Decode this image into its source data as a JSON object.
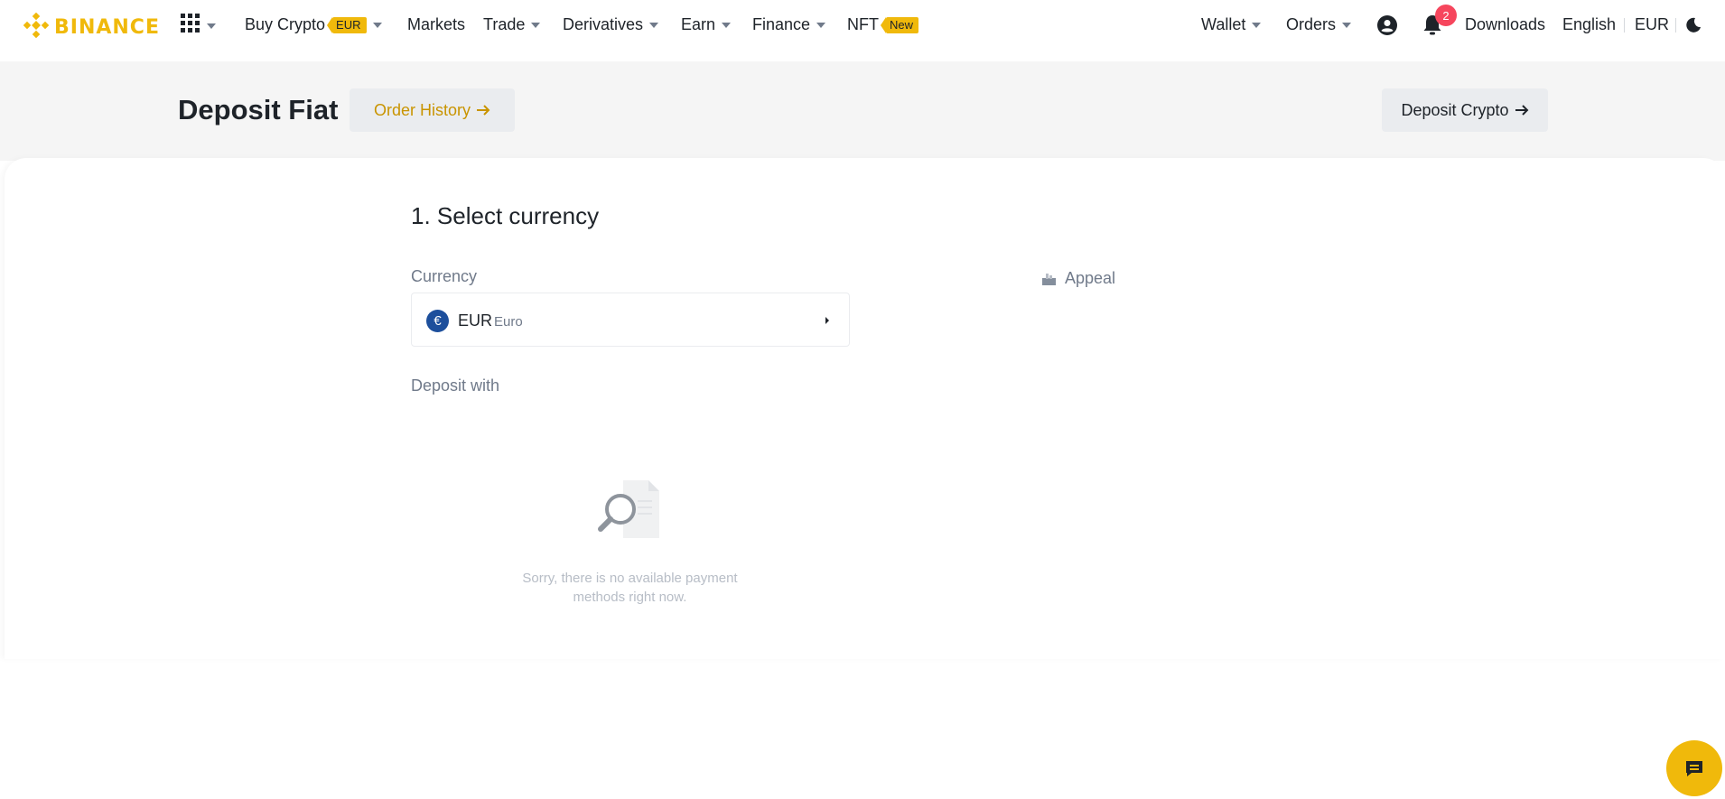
{
  "brand": {
    "name": "BINANCE",
    "color": "#F0B90B"
  },
  "nav": {
    "buy_crypto": "Buy Crypto",
    "buy_crypto_tag": "EUR",
    "markets": "Markets",
    "trade": "Trade",
    "derivatives": "Derivatives",
    "earn": "Earn",
    "finance": "Finance",
    "nft": "NFT",
    "nft_tag": "New",
    "wallet": "Wallet",
    "orders": "Orders",
    "notifications_count": "2",
    "downloads": "Downloads",
    "language": "English",
    "currency": "EUR"
  },
  "header": {
    "title": "Deposit Fiat",
    "order_history": "Order History",
    "deposit_crypto": "Deposit Crypto"
  },
  "form": {
    "step_title": "1. Select currency",
    "currency_label": "Currency",
    "selected_currency": {
      "code": "EUR",
      "name": "Euro",
      "symbol": "€"
    },
    "deposit_with_label": "Deposit with",
    "appeal": "Appeal",
    "empty_message": "Sorry, there is no available payment methods right now."
  },
  "icons": [
    "binance-logo-icon",
    "apps-grid-icon",
    "user-icon",
    "bell-icon",
    "moon-icon",
    "arrow-right-icon",
    "appeal-icon",
    "no-results-icon",
    "chat-icon"
  ],
  "colors": {
    "accent": "#F0B90B",
    "order_history_text": "#C99400",
    "badge": "#F6465D"
  }
}
